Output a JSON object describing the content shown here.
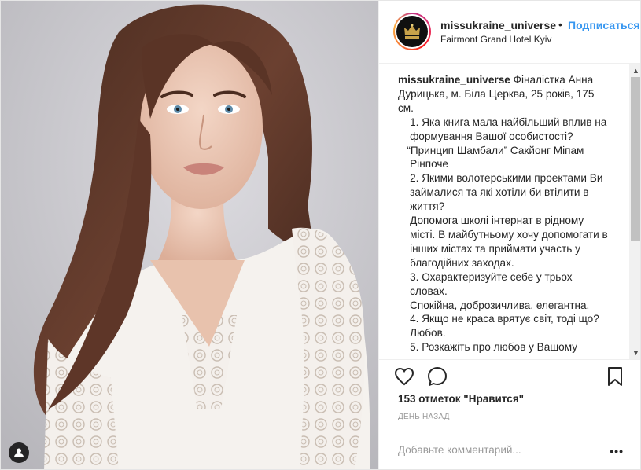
{
  "header": {
    "username": "missukraine_universe",
    "dot": "•",
    "follow_label": "Подписаться",
    "location": "Fairmont Grand Hotel Kyiv"
  },
  "caption": {
    "username": "missukraine_universe",
    "text": " Фіналістка Анна\nДурицька, м. Біла Церква, 25 років, 175\nсм.\n    1. Яка книга мала найбільший вплив на\n    формування Вашої особистості?\n   “Принцип Шамбали” Сакйонг Міпам\n    Рінпоче\n    2. Якими волотерськими проектами Ви\n    займалися та які хотіли би втілити в\n    життя?\n    Допомога школі інтернат в рідному\n    місті. В майбутньому хочу допомогати в\n    інших містах та приймати участь у\n    благодійних заходах.\n    3. Охарактеризуйте себе у трьох\n    словах.\n    Спокійна, доброзичлива, елегантна.\n    4. Якщо не краса врятує світ, тоді що?\n    Любов.\n    5. Розкажіть про любов у Вашому"
  },
  "stats": {
    "likes_label": "153 отметок \"Нравится\"",
    "time_label": "ДЕНЬ НАЗАД"
  },
  "comment_box": {
    "placeholder": "Добавьте комментарий...",
    "more_label": "•••"
  },
  "icons": {
    "like": "heart-icon",
    "comment": "comment-icon",
    "save": "bookmark-icon",
    "tag": "user-tag-icon",
    "avatar_logo": "crown-icon"
  },
  "colors": {
    "follow": "#3897f0",
    "text": "#262626",
    "muted": "#999999",
    "border": "#efefef"
  }
}
